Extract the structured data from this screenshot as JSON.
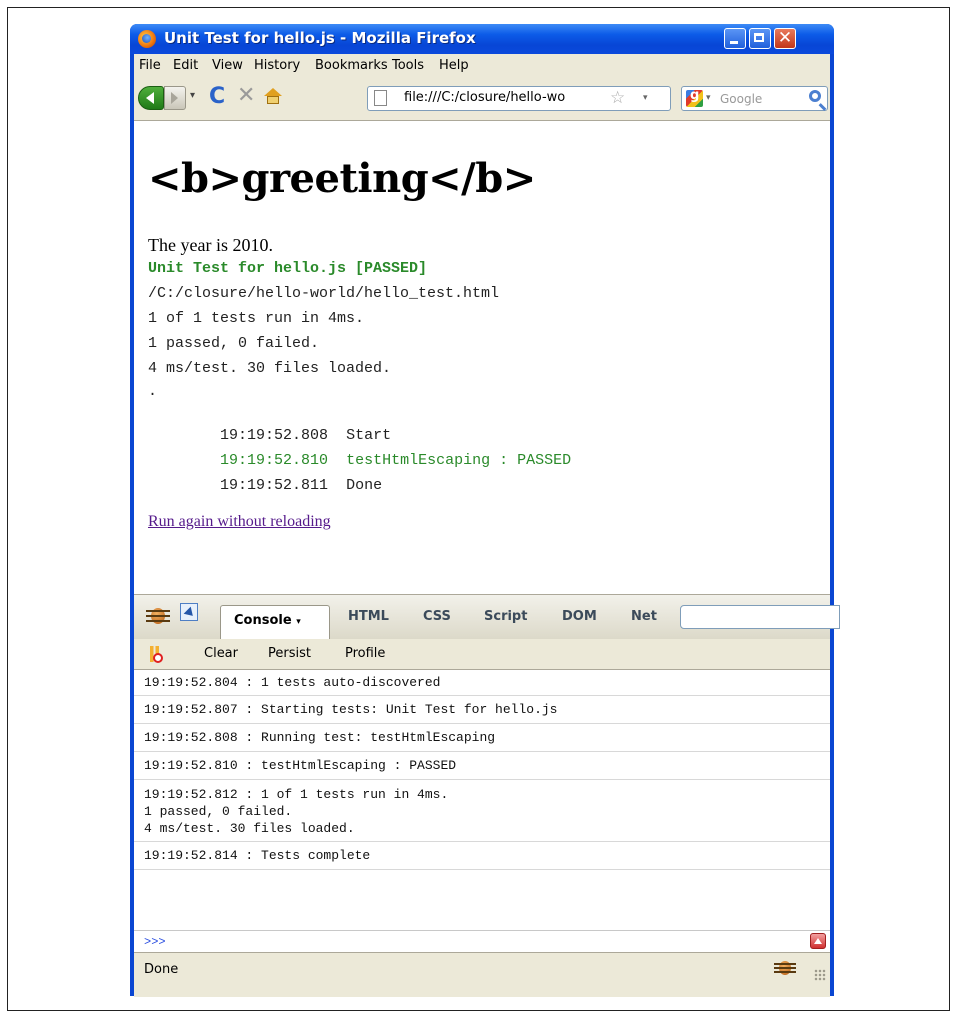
{
  "window": {
    "title": "Unit Test for hello.js - Mozilla Firefox"
  },
  "menu": [
    "File",
    "Edit",
    "View",
    "History",
    "Bookmarks",
    "Tools",
    "Help"
  ],
  "navbar": {
    "url": "file:///C:/closure/hello-wo",
    "search_placeholder": "Google"
  },
  "page": {
    "heading": "<b>greeting</b>",
    "year_text": "The year is 2010.",
    "test_title": "Unit Test for hello.js [PASSED]",
    "test_lines": [
      "/C:/closure/hello-world/hello_test.html",
      "1 of 1 tests run in 4ms.",
      "1 passed, 0 failed.",
      "4 ms/test. 30 files loaded.",
      "."
    ],
    "log": [
      {
        "time": "19:19:52.808",
        "text": "Start",
        "status": "normal"
      },
      {
        "time": "19:19:52.810",
        "text": "testHtmlEscaping : PASSED",
        "status": "passed"
      },
      {
        "time": "19:19:52.811",
        "text": "Done",
        "status": "normal"
      }
    ],
    "run_again_link": "Run again without reloading"
  },
  "firebug": {
    "tabs": [
      "Console",
      "HTML",
      "CSS",
      "Script",
      "DOM",
      "Net"
    ],
    "active_tab": "Console",
    "active_tab_caret": "▾",
    "toolbar": [
      "Clear",
      "Persist",
      "Profile"
    ],
    "console_rows": [
      "19:19:52.804 : 1 tests auto-discovered",
      "19:19:52.807 : Starting tests: Unit Test for hello.js",
      "19:19:52.808 : Running test: testHtmlEscaping",
      "19:19:52.810 : testHtmlEscaping : PASSED",
      "19:19:52.812 : 1 of 1 tests run in 4ms.\n1 passed, 0 failed.\n4 ms/test. 30 files loaded.",
      "19:19:52.814 : Tests complete"
    ],
    "prompt": ">>>"
  },
  "status": {
    "text": "Done"
  },
  "colors": {
    "pass_green": "#2a8a2a",
    "link_visited": "#551a8b",
    "titlebar_blue": "#0a46d2"
  },
  "icons": {
    "close": "✕",
    "reload": "C",
    "stop": "✕",
    "star": "☆",
    "dropdown": "▾"
  }
}
